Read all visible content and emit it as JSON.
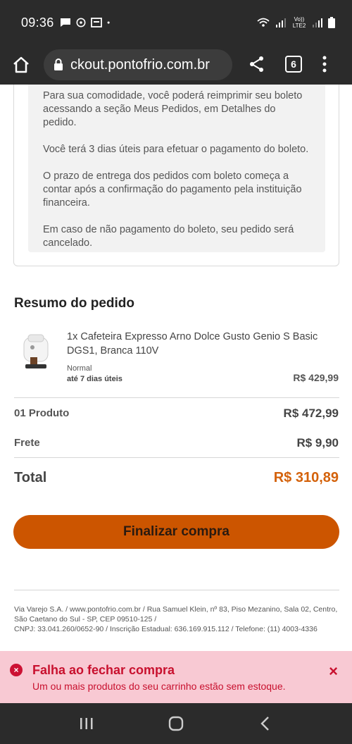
{
  "status_bar": {
    "time": "09:36",
    "network_label": "Vo)) LTE2"
  },
  "browser": {
    "url": "ckout.pontofrio.com.br",
    "tab_count": "6"
  },
  "info_box": {
    "paragraphs": [
      "Para sua comodidade, você poderá reimprimir seu boleto acessando a seção Meus Pedidos, em Detalhes do pedido.",
      "Você terá 3 dias úteis para efetuar o pagamento do boleto.",
      "O prazo de entrega dos pedidos com boleto começa a contar após a confirmação do pagamento pela instituição financeira.",
      "Em caso de não pagamento do boleto, seu pedido será cancelado."
    ]
  },
  "summary": {
    "title": "Resumo do pedido",
    "product": {
      "name": "1x Cafeteira Expresso Arno Dolce Gusto Genio S Basic DGS1, Branca 110V",
      "shipping_type": "Normal",
      "shipping_time": "até 7 dias úteis",
      "price": "R$ 429,99"
    },
    "products_label": "01 Produto",
    "products_value": "R$ 472,99",
    "freight_label": "Frete",
    "freight_value": "R$ 9,90",
    "total_label": "Total",
    "total_value": "R$ 310,89",
    "finalize_label": "Finalizar compra"
  },
  "footer": {
    "line1": "Via Varejo S.A. / www.pontofrio.com.br / Rua Samuel Klein, nº 83, Piso Mezanino, Sala 02, Centro, São Caetano do Sul - SP, CEP 09510-125 /",
    "line2": "CNPJ: 33.041.260/0652-90 / Inscrição Estadual: 636.169.915.112 / Telefone: (11) 4003-4336"
  },
  "toast": {
    "title": "Falha ao fechar compra",
    "message": "Um ou mais produtos do seu carrinho estão sem estoque.",
    "close_symbol": "×",
    "error_symbol": "×"
  },
  "colors": {
    "accent": "#cc5500",
    "total": "#d4620b",
    "error": "#c8102e",
    "toast_bg": "#f8c9d3",
    "chrome": "#2b2b2b"
  }
}
